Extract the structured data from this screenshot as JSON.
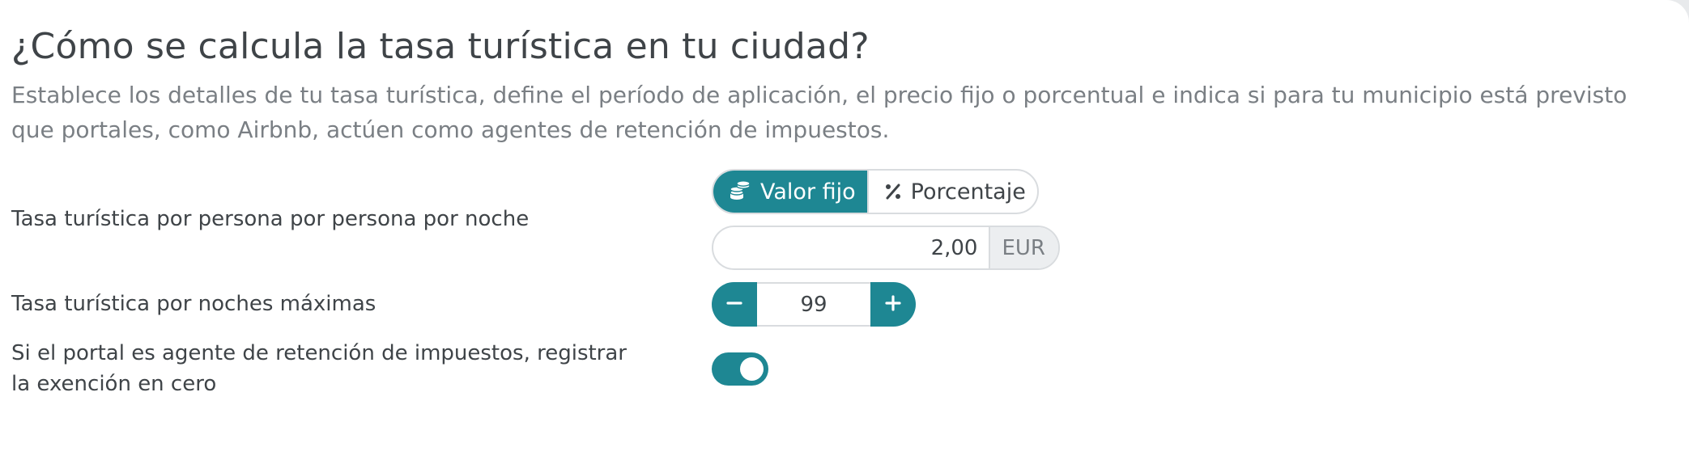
{
  "header": {
    "title": "¿Cómo se calcula la tasa turística en tu ciudad?",
    "description": "Establece los detalles de tu tasa turística, define el período de aplicación, el precio fijo o porcentual e indica si para tu municipio está previsto que portales, como Airbnb, actúen como agentes de retención de impuestos."
  },
  "tax_per_person": {
    "label": "Tasa turística por persona por persona por noche",
    "mode_options": [
      {
        "label": "Valor fijo",
        "icon": "coins-icon",
        "selected": true
      },
      {
        "label": "Porcentaje",
        "icon": "percent-icon",
        "selected": false
      }
    ],
    "amount_value": "2,00",
    "currency": "EUR"
  },
  "max_nights": {
    "label": "Tasa turística por noches máximas",
    "value": "99"
  },
  "exemption": {
    "label": "Si el portal es agente de retención de impuestos, registrar la exención en cero",
    "enabled": true
  },
  "colors": {
    "accent": "#1e8793",
    "border": "#d9dcdf",
    "text": "#3f4448",
    "muted_text": "#7a7f84",
    "addon_bg": "#eceef0"
  }
}
